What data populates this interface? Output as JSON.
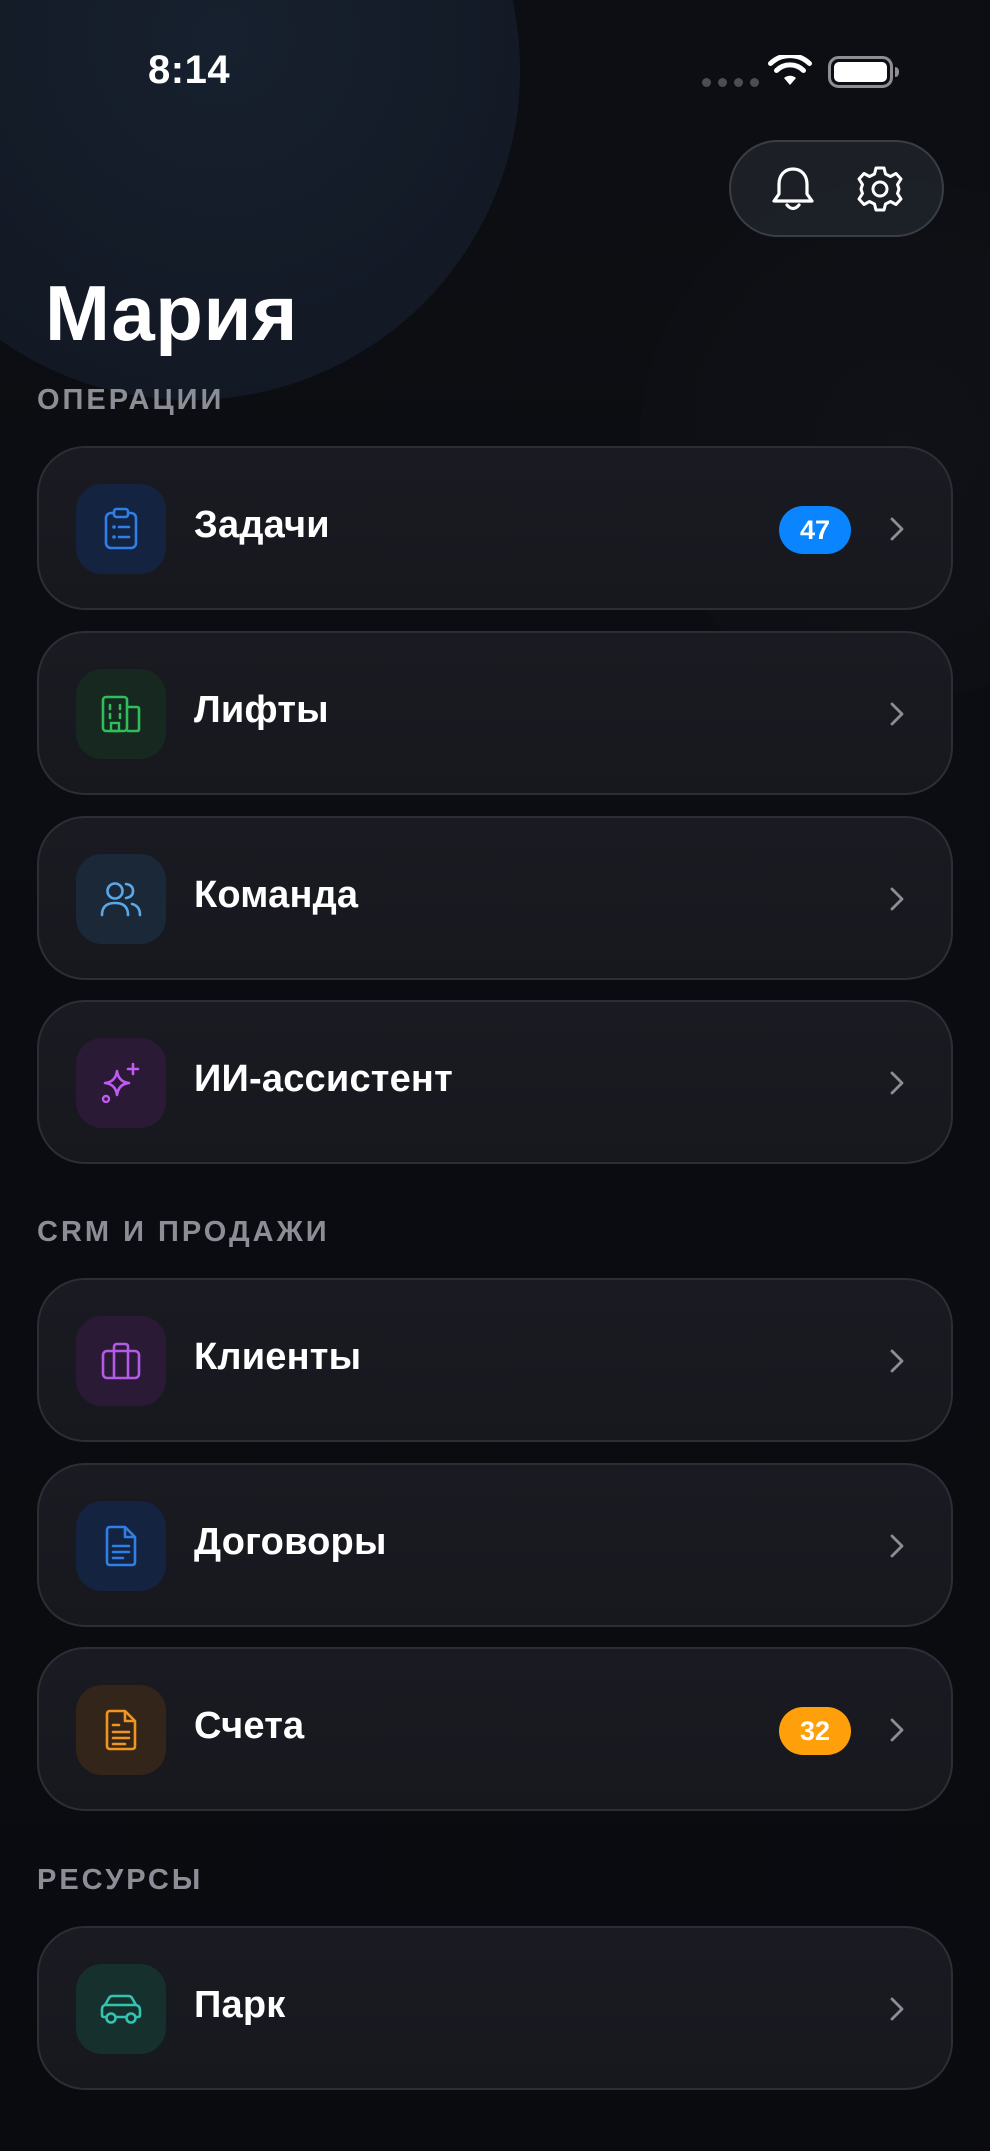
{
  "status_bar": {
    "time": "8:14"
  },
  "header": {
    "title": "Мария",
    "notifications_icon": "bell-icon",
    "settings_icon": "gear-icon"
  },
  "sections": [
    {
      "title": "ОПЕРАЦИИ",
      "items": [
        {
          "label": "Задачи",
          "icon": "clipboard-list-icon",
          "badge": "47",
          "badge_color": "#0a84ff",
          "tile_color": "#14233f",
          "icon_color": "#2f7fe8"
        },
        {
          "label": "Лифты",
          "icon": "building-icon",
          "badge": null,
          "tile_color": "#16281f",
          "icon_color": "#2fbf5a"
        },
        {
          "label": "Команда",
          "icon": "users-icon",
          "badge": null,
          "tile_color": "#1b2838",
          "icon_color": "#5aa8e6"
        },
        {
          "label": "ИИ-ассистент",
          "icon": "sparkles-icon",
          "badge": null,
          "tile_color": "#2a1a35",
          "icon_color": "#bf5af2"
        }
      ]
    },
    {
      "title": "CRM И ПРОДАЖИ",
      "items": [
        {
          "label": "Клиенты",
          "icon": "briefcase-icon",
          "badge": null,
          "tile_color": "#2a1a35",
          "icon_color": "#b25be6"
        },
        {
          "label": "Договоры",
          "icon": "document-icon",
          "badge": null,
          "tile_color": "#14233f",
          "icon_color": "#2f7fe8"
        },
        {
          "label": "Счета",
          "icon": "invoice-icon",
          "badge": "32",
          "badge_color": "#ff9f0a",
          "tile_color": "#33251a",
          "icon_color": "#f0961e"
        }
      ]
    },
    {
      "title": "РЕСУРСЫ",
      "items": [
        {
          "label": "Парк",
          "icon": "car-icon",
          "badge": null,
          "tile_color": "#16302e",
          "icon_color": "#34c3b0"
        }
      ]
    }
  ]
}
